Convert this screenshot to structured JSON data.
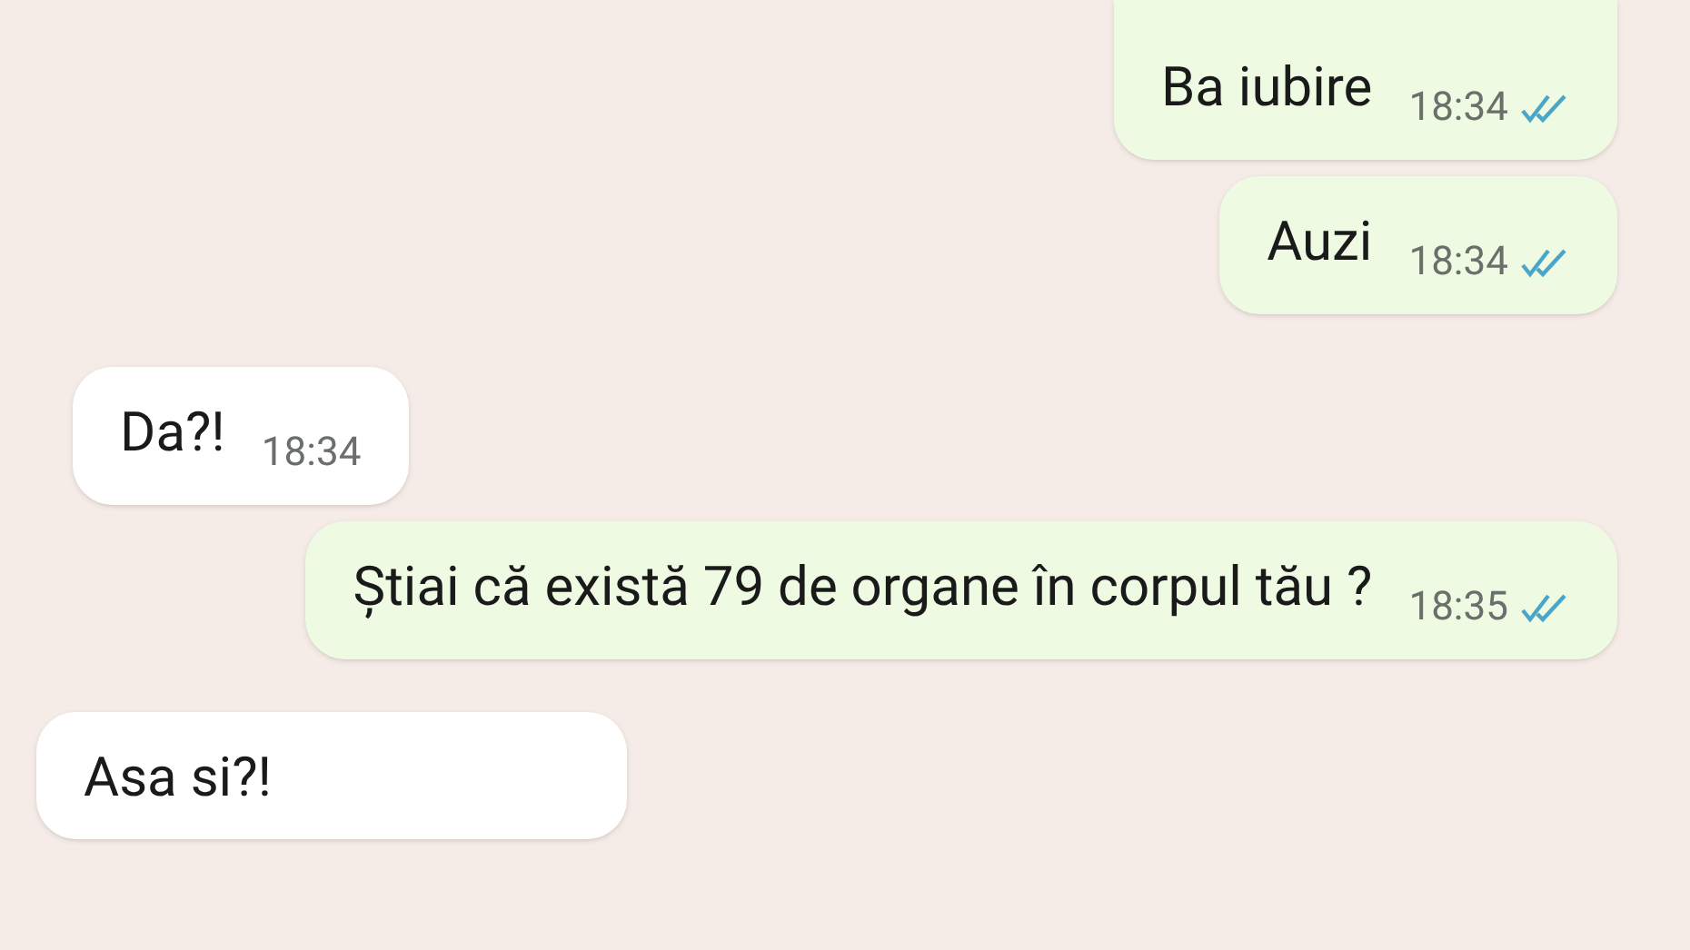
{
  "messages": [
    {
      "kind": "outgoing",
      "text": "Ba iubire",
      "time": "18:34",
      "read": true
    },
    {
      "kind": "outgoing",
      "text": "Auzi",
      "time": "18:34",
      "read": true
    },
    {
      "kind": "incoming",
      "text": "Da?!",
      "time": "18:34"
    },
    {
      "kind": "outgoing",
      "text": "Știai că există 79 de organe în corpul tău ?",
      "time": "18:35",
      "read": true
    },
    {
      "kind": "incoming",
      "text": "Asa si?!"
    }
  ]
}
